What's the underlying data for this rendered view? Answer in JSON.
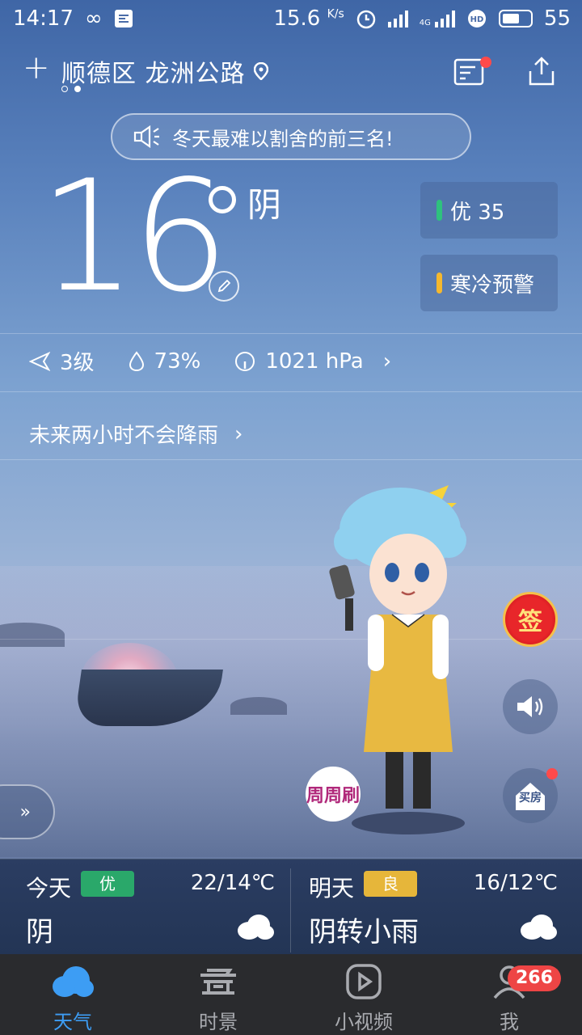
{
  "status_bar": {
    "time": "14:17",
    "net_speed": "15.6",
    "net_unit": "K/s",
    "network": "4G",
    "battery": "55"
  },
  "header": {
    "location": "顺德区 龙洲公路",
    "add_icon": "plus-icon",
    "news_icon": "news-icon",
    "share_icon": "share-icon"
  },
  "announcement": {
    "text": "冬天最难以割舍的前三名!"
  },
  "current": {
    "temperature": "16",
    "condition": "阴"
  },
  "air_quality": {
    "label": "优 35",
    "color": "#2ec27e"
  },
  "warning": {
    "label": "寒冷预警",
    "color": "#f5b82e"
  },
  "metrics": {
    "wind": "3级",
    "humidity": "73%",
    "pressure": "1021 hPa"
  },
  "rain_forecast": {
    "text": "未来两小时不会降雨"
  },
  "side_buttons": {
    "sign": "签",
    "house": "买房",
    "zhouzhou": "周周刷"
  },
  "forecast": [
    {
      "day": "今天",
      "aqi": "优",
      "aqi_color": "#2aa86a",
      "range": "22/14℃",
      "weather": "阴"
    },
    {
      "day": "明天",
      "aqi": "良",
      "aqi_color": "#e6b63a",
      "range": "16/12℃",
      "weather": "阴转小雨"
    }
  ],
  "nav": {
    "weather": "天气",
    "scenery": "时景",
    "video": "小视频",
    "me": "我",
    "me_badge": "266"
  }
}
